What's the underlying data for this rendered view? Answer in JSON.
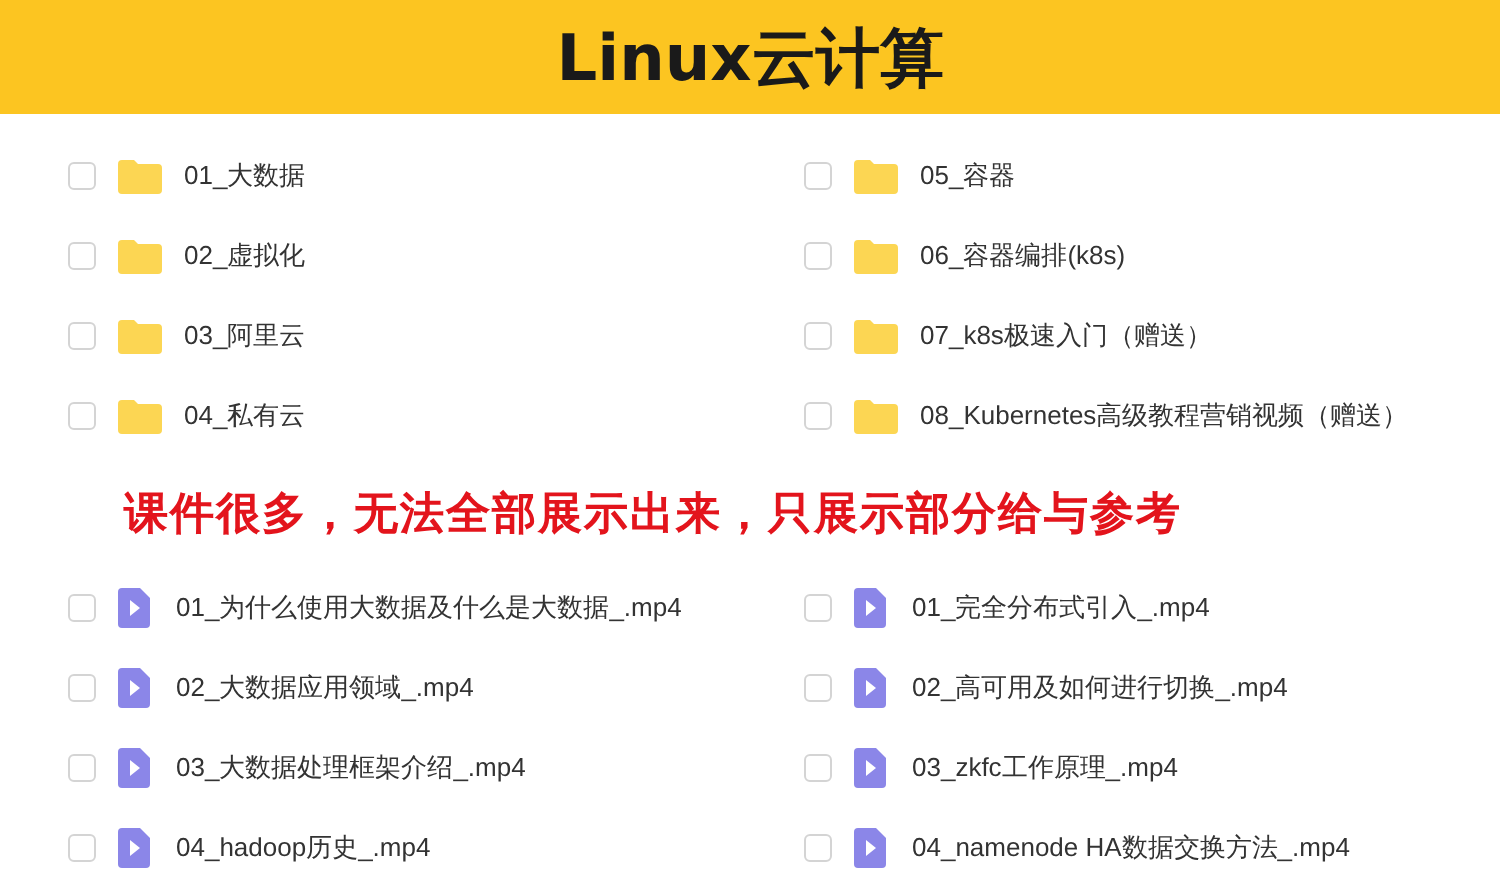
{
  "banner": {
    "title": "Linux云计算"
  },
  "folders": [
    {
      "name": "01_大数据",
      "checked": false
    },
    {
      "name": "02_虚拟化",
      "checked": false
    },
    {
      "name": "03_阿里云",
      "checked": false
    },
    {
      "name": "04_私有云",
      "checked": false
    },
    {
      "name": "05_容器",
      "checked": false
    },
    {
      "name": "06_容器编排(k8s)",
      "checked": false
    },
    {
      "name": "07_k8s极速入门（赠送）",
      "checked": false
    },
    {
      "name": "08_Kubernetes高级教程营销视频（赠送）",
      "checked": false
    }
  ],
  "notice": "课件很多，无法全部展示出来，只展示部分给与参考",
  "videos": [
    {
      "name": "01_为什么使用大数据及什么是大数据_.mp4",
      "checked": false
    },
    {
      "name": "02_大数据应用领域_.mp4",
      "checked": false
    },
    {
      "name": "03_大数据处理框架介绍_.mp4",
      "checked": false
    },
    {
      "name": "04_hadoop历史_.mp4",
      "checked": false
    },
    {
      "name": "01_完全分布式引入_.mp4",
      "checked": false
    },
    {
      "name": "02_高可用及如何进行切换_.mp4",
      "checked": false
    },
    {
      "name": "03_zkfc工作原理_.mp4",
      "checked": false
    },
    {
      "name": "04_namenode HA数据交换方法_.mp4",
      "checked": false
    }
  ]
}
